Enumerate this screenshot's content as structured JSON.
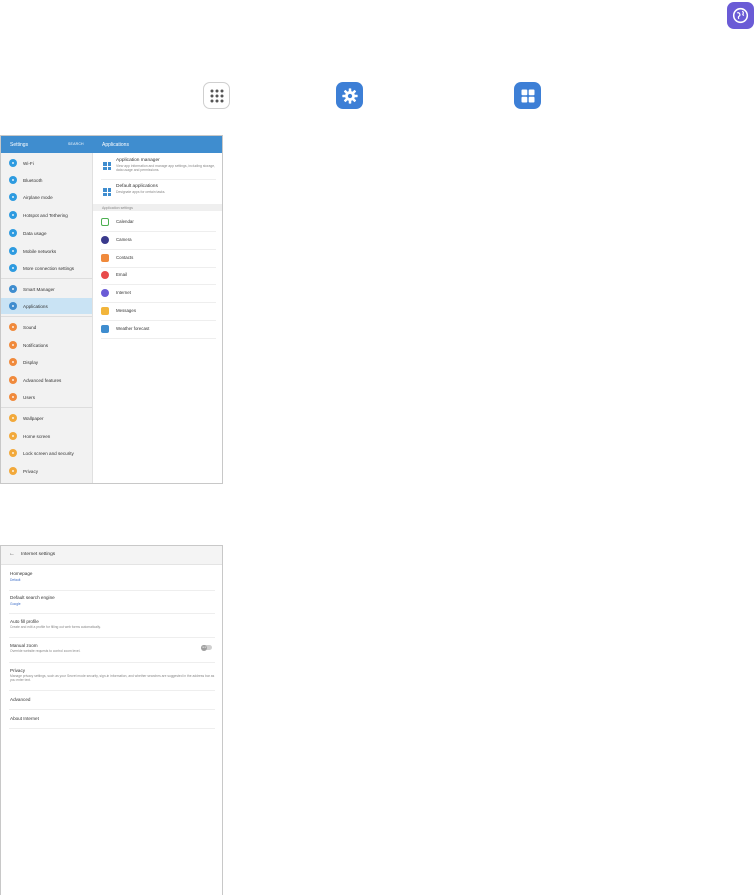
{
  "icons": {
    "internet": {
      "icon": "internet-globe-icon",
      "color": "#6a5bd6"
    },
    "apps": {
      "icon": "apps-grid-icon"
    },
    "settings": {
      "icon": "settings-gear-icon",
      "color": "#3d7fd6"
    },
    "applications": {
      "icon": "applications-icon",
      "color": "#3d7fd6"
    }
  },
  "settings_screen": {
    "header": {
      "title": "Settings",
      "search": "SEARCH",
      "panel_title": "Applications"
    },
    "left_items": [
      {
        "label": "Wi-Fi",
        "color": "#2e9be0"
      },
      {
        "label": "Bluetooth",
        "color": "#2e9be0"
      },
      {
        "label": "Airplane mode",
        "color": "#2e9be0"
      },
      {
        "label": "Hotspot and Tethering",
        "color": "#2e9be0"
      },
      {
        "label": "Data usage",
        "color": "#2e9be0"
      },
      {
        "label": "Mobile networks",
        "color": "#2e9be0"
      },
      {
        "label": "More connection settings",
        "color": "#2e9be0"
      },
      {
        "label": "Smart Manager",
        "color": "#3f8dcf"
      },
      {
        "label": "Applications",
        "color": "#3f8dcf",
        "selected": true
      },
      {
        "label": "Sound",
        "color": "#f08a3c"
      },
      {
        "label": "Notifications",
        "color": "#f08a3c"
      },
      {
        "label": "Display",
        "color": "#f08a3c"
      },
      {
        "label": "Advanced features",
        "color": "#f08a3c"
      },
      {
        "label": "Users",
        "color": "#f08a3c"
      },
      {
        "label": "Wallpaper",
        "color": "#f2a93b"
      },
      {
        "label": "Home screen",
        "color": "#f2a93b"
      },
      {
        "label": "Lock screen and security",
        "color": "#f2a93b"
      },
      {
        "label": "Privacy",
        "color": "#f2a93b"
      }
    ],
    "right": {
      "app_manager": {
        "title": "Application manager",
        "desc": "View app information and manage app settings, including storage, data usage and permissions."
      },
      "default_apps": {
        "title": "Default applications",
        "desc": "Designate apps for certain tasks."
      },
      "section": "Application settings",
      "items": [
        {
          "label": "Calendar",
          "color": "#4caf50"
        },
        {
          "label": "Camera",
          "color": "#3a3a8c"
        },
        {
          "label": "Contacts",
          "color": "#f08a3c"
        },
        {
          "label": "Email",
          "color": "#e84b4b"
        },
        {
          "label": "Internet",
          "color": "#6a5bd6"
        },
        {
          "label": "Messages",
          "color": "#f2b53b"
        },
        {
          "label": "Weather forecast",
          "color": "#3f8dcf"
        }
      ]
    }
  },
  "internet_screen": {
    "header": {
      "title": "Internet settings"
    },
    "homepage": {
      "title": "Homepage",
      "value": "Default"
    },
    "search_engine": {
      "title": "Default search engine",
      "value": "Google"
    },
    "auto_fill": {
      "title": "Auto fill profile",
      "desc": "Create and edit a profile for filling out web forms automatically."
    },
    "manual_zoom": {
      "title": "Manual zoom",
      "desc": "Override website requests to control zoom level.",
      "toggle": "OFF"
    },
    "privacy": {
      "title": "Privacy",
      "desc": "Manage privacy settings, such as your Secret mode security, sign-in information, and whether searches are suggested in the address bar as you enter text."
    },
    "advanced": {
      "title": "Advanced"
    },
    "about": {
      "title": "About Internet"
    }
  }
}
